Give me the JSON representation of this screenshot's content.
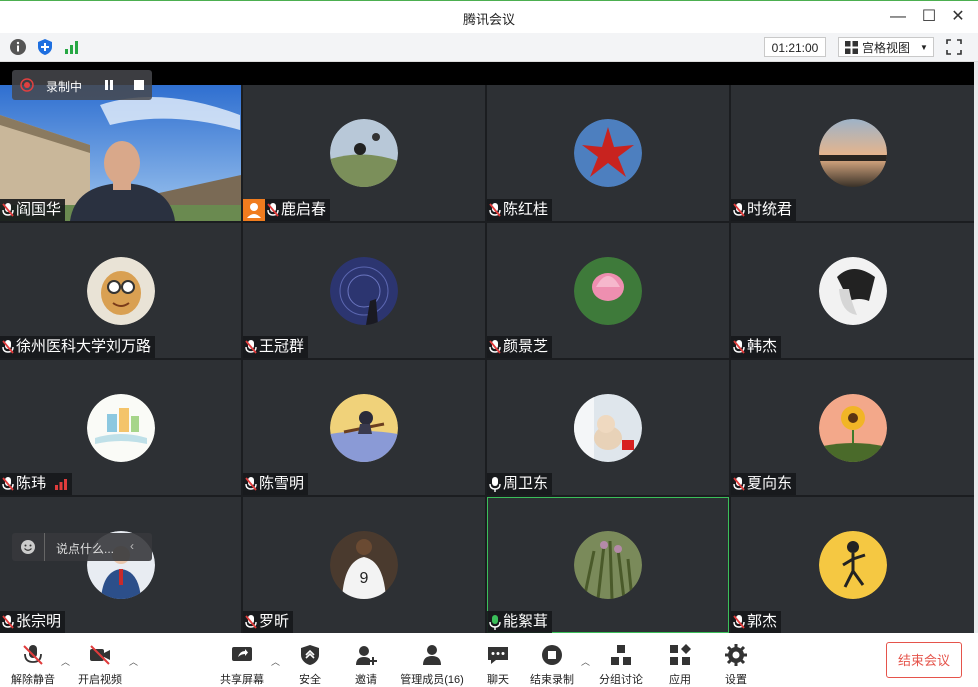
{
  "window": {
    "title": "腾讯会议",
    "minimize": "—",
    "maximize": "☐",
    "close": "✕"
  },
  "topbar": {
    "timer": "01:21:00",
    "view_label": "宫格视图",
    "icons": [
      "info-icon",
      "shield-icon",
      "signal-icon",
      "grid-view-icon",
      "fullscreen-icon"
    ]
  },
  "recording": {
    "label": "录制中"
  },
  "chat": {
    "placeholder": "说点什么..."
  },
  "participants": [
    {
      "name": "阎国华",
      "mic": "muted",
      "type": "video"
    },
    {
      "name": "鹿启春",
      "mic": "muted",
      "type": "avatar",
      "badge": "person"
    },
    {
      "name": "陈红桂",
      "mic": "muted",
      "type": "avatar"
    },
    {
      "name": "时统君",
      "mic": "muted",
      "type": "avatar"
    },
    {
      "name": "徐州医科大学刘万路",
      "mic": "muted",
      "type": "avatar"
    },
    {
      "name": "王冠群",
      "mic": "muted",
      "type": "avatar"
    },
    {
      "name": "颜景芝",
      "mic": "muted",
      "type": "avatar"
    },
    {
      "name": "韩杰",
      "mic": "muted",
      "type": "avatar"
    },
    {
      "name": "陈玮",
      "mic": "muted",
      "type": "avatar",
      "signal": true
    },
    {
      "name": "陈雪明",
      "mic": "muted",
      "type": "avatar"
    },
    {
      "name": "周卫东",
      "mic": "on",
      "type": "avatar"
    },
    {
      "name": "夏向东",
      "mic": "muted",
      "type": "avatar"
    },
    {
      "name": "张宗明",
      "mic": "muted",
      "type": "avatar"
    },
    {
      "name": "罗昕",
      "mic": "muted",
      "type": "avatar"
    },
    {
      "name": "能絮茸",
      "mic": "speaking",
      "type": "avatar",
      "active": true
    },
    {
      "name": "郭杰",
      "mic": "muted",
      "type": "avatar"
    }
  ],
  "bottombar": {
    "unmute": "解除静音",
    "start_video": "开启视频",
    "share": "共享屏幕",
    "security": "安全",
    "invite": "邀请",
    "members": "管理成员(16)",
    "chat": "聊天",
    "end_recording": "结束录制",
    "breakout": "分组讨论",
    "apps": "应用",
    "settings": "设置",
    "end_meeting": "结束会议"
  },
  "colors": {
    "accent_green": "#3bbf5a",
    "end_red": "#e5544b",
    "tile_bg": "#2d3034",
    "badge_orange": "#f07c1e"
  }
}
